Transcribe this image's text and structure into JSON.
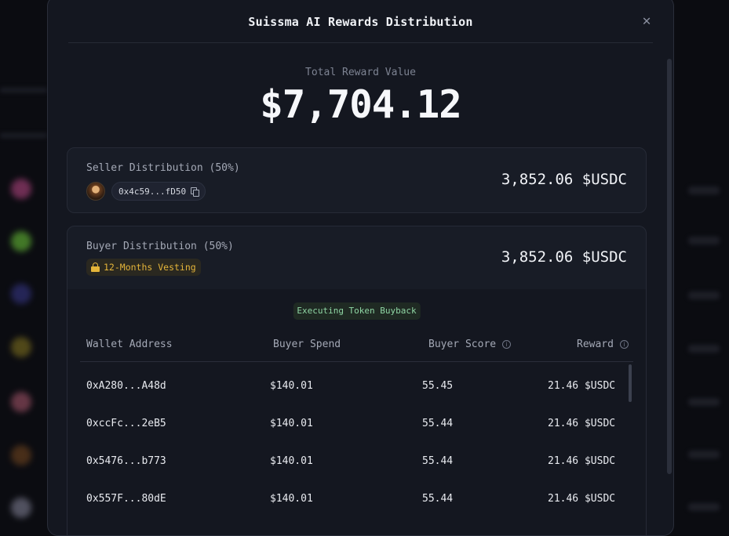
{
  "modal": {
    "title": "Suissma AI Rewards Distribution",
    "close_icon": "close-icon"
  },
  "total": {
    "label": "Total Reward Value",
    "value": "$7,704.12"
  },
  "seller": {
    "label": "Seller Distribution (50%)",
    "address": "0x4c59...fD50",
    "amount": "3,852.06 $USDC"
  },
  "buyer": {
    "label": "Buyer Distribution (50%)",
    "vesting": "12-Months Vesting",
    "amount": "3,852.06 $USDC",
    "status": "Executing Token Buyback",
    "columns": {
      "wallet": "Wallet Address",
      "spend": "Buyer Spend",
      "score": "Buyer Score",
      "reward": "Reward"
    },
    "rows": [
      {
        "wallet": "0xA280...A48d",
        "spend": "$140.01",
        "score": "55.45",
        "reward": "21.46 $USDC"
      },
      {
        "wallet": "0xccFc...2eB5",
        "spend": "$140.01",
        "score": "55.44",
        "reward": "21.46 $USDC"
      },
      {
        "wallet": "0x5476...b773",
        "spend": "$140.01",
        "score": "55.44",
        "reward": "21.46 $USDC"
      },
      {
        "wallet": "0x557F...80dE",
        "spend": "$140.01",
        "score": "55.44",
        "reward": "21.46 $USDC"
      }
    ]
  },
  "colors": {
    "modal_bg": "#141720",
    "card_bg": "#181c26",
    "vesting": "#e5b53a",
    "buyback": "#8fd6a4"
  }
}
